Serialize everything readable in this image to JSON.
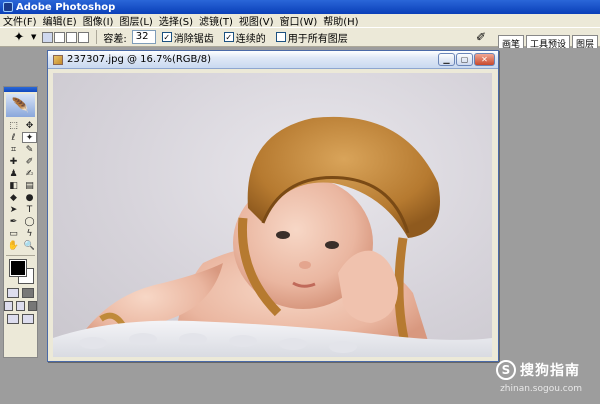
{
  "app": {
    "title": "Adobe Photoshop"
  },
  "menu": [
    "文件(F)",
    "编辑(E)",
    "图像(I)",
    "图层(L)",
    "选择(S)",
    "滤镜(T)",
    "视图(V)",
    "窗口(W)",
    "帮助(H)"
  ],
  "options": {
    "tolerance_label": "容差:",
    "tolerance_value": "32",
    "antialias_label": "消除锯齿",
    "antialias_checked": true,
    "contiguous_label": "连续的",
    "contiguous_checked": true,
    "sample_all_label": "用于所有图层",
    "sample_all_checked": false,
    "palette_tabs": [
      "画笔",
      "工具预设",
      "图层"
    ]
  },
  "document": {
    "title": "237307.jpg @ 16.7%(RGB/8)"
  },
  "toolbox": {
    "tools": [
      {
        "name": "marquee-icon",
        "glyph": "⬚"
      },
      {
        "name": "move-icon",
        "glyph": "✥"
      },
      {
        "name": "lasso-icon",
        "glyph": "ℓ"
      },
      {
        "name": "magic-wand-icon",
        "glyph": "✦",
        "selected": true
      },
      {
        "name": "crop-icon",
        "glyph": "⌗"
      },
      {
        "name": "slice-icon",
        "glyph": "✎"
      },
      {
        "name": "healing-icon",
        "glyph": "✚"
      },
      {
        "name": "brush-icon",
        "glyph": "✐"
      },
      {
        "name": "stamp-icon",
        "glyph": "♟"
      },
      {
        "name": "history-brush-icon",
        "glyph": "✍"
      },
      {
        "name": "eraser-icon",
        "glyph": "◧"
      },
      {
        "name": "gradient-icon",
        "glyph": "▤"
      },
      {
        "name": "blur-icon",
        "glyph": "◆"
      },
      {
        "name": "dodge-icon",
        "glyph": "●"
      },
      {
        "name": "path-select-icon",
        "glyph": "➤"
      },
      {
        "name": "type-icon",
        "glyph": "T"
      },
      {
        "name": "pen-icon",
        "glyph": "✒"
      },
      {
        "name": "shape-icon",
        "glyph": "◯"
      },
      {
        "name": "notes-icon",
        "glyph": "▭"
      },
      {
        "name": "eyedropper-icon",
        "glyph": "ϟ"
      },
      {
        "name": "hand-icon",
        "glyph": "✋"
      },
      {
        "name": "zoom-icon",
        "glyph": "🔍"
      }
    ],
    "foreground_color": "#000000",
    "background_color": "#ffffff"
  },
  "watermark": {
    "text": "搜狗指南",
    "sub": "zhinan.sogou.com",
    "logo": "S"
  }
}
